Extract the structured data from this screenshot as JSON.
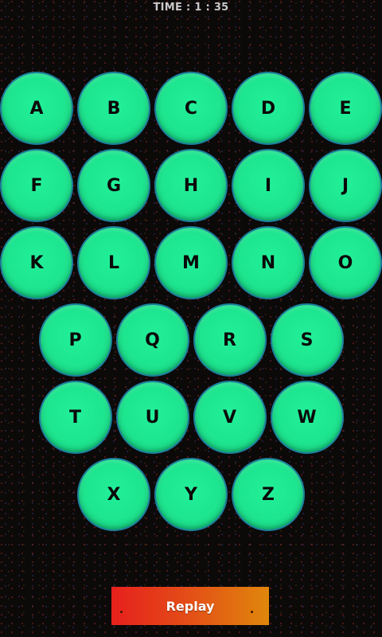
{
  "timer": {
    "text": "TIME : 1 : 35"
  },
  "letters": {
    "rows": [
      [
        "A",
        "B",
        "C",
        "D",
        "E"
      ],
      [
        "F",
        "G",
        "H",
        "I",
        "J"
      ],
      [
        "K",
        "L",
        "M",
        "N",
        "O"
      ],
      [
        "P",
        "Q",
        "R",
        "S"
      ],
      [
        "T",
        "U",
        "V",
        "W"
      ],
      [
        "X",
        "Y",
        "Z"
      ]
    ]
  },
  "replay": {
    "label": "Replay"
  },
  "colors": {
    "ball_fill": "#1ee58f",
    "ball_border": "#1b7f9c",
    "replay_start": "#e6201d",
    "replay_end": "#e0870c",
    "background": "#0c0909"
  }
}
